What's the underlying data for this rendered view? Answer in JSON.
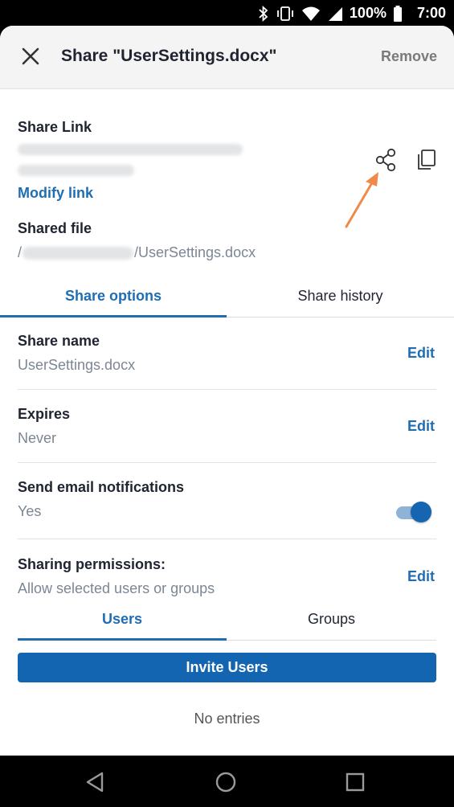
{
  "status_bar": {
    "battery": "100%",
    "time": "7:00",
    "icons": [
      "bluetooth-icon",
      "vibrate-icon",
      "wifi-icon",
      "signal-icon",
      "battery-icon"
    ]
  },
  "header": {
    "title": "Share \"UserSettings.docx\"",
    "remove_label": "Remove"
  },
  "share_link": {
    "label": "Share Link",
    "modify_label": "Modify link"
  },
  "shared_file": {
    "label": "Shared file",
    "path_prefix": "/",
    "path_suffix": "/UserSettings.docx"
  },
  "tabs": {
    "share_options": "Share options",
    "share_history": "Share history"
  },
  "options": {
    "share_name": {
      "label": "Share name",
      "value": "UserSettings.docx",
      "edit": "Edit"
    },
    "expires": {
      "label": "Expires",
      "value": "Never",
      "edit": "Edit"
    },
    "email": {
      "label": "Send email notifications",
      "value": "Yes",
      "enabled": true
    },
    "permissions": {
      "label": "Sharing permissions:",
      "value": "Allow selected users or groups",
      "edit": "Edit"
    }
  },
  "subtabs": {
    "users": "Users",
    "groups": "Groups"
  },
  "invite_label": "Invite Users",
  "empty_label": "No entries",
  "colors": {
    "accent": "#1f6db3",
    "button": "#1465b1",
    "annotation_arrow": "#f08a4b"
  }
}
